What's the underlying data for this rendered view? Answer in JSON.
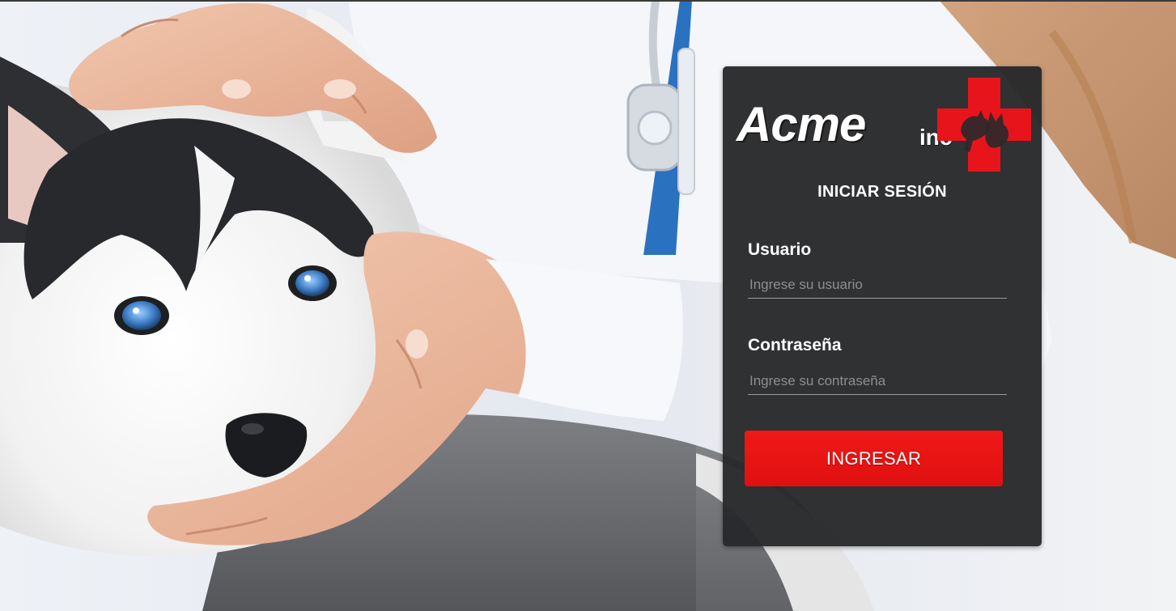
{
  "brand": {
    "name": "Acme",
    "suffix": "inc",
    "accent_color": "#e8141b",
    "logo_icon": "medical-cross-pets-icon"
  },
  "login": {
    "title": "INICIAR SESIÓN",
    "username": {
      "label": "Usuario",
      "placeholder": "Ingrese su usuario",
      "value": ""
    },
    "password": {
      "label": "Contraseña",
      "placeholder": "Ingrese su contraseña",
      "value": ""
    },
    "submit_label": "INGRESAR",
    "button_color": "#ec1515",
    "panel_color": "#28292b"
  },
  "background": {
    "subject": "husky-puppy-veterinarian-photo"
  }
}
